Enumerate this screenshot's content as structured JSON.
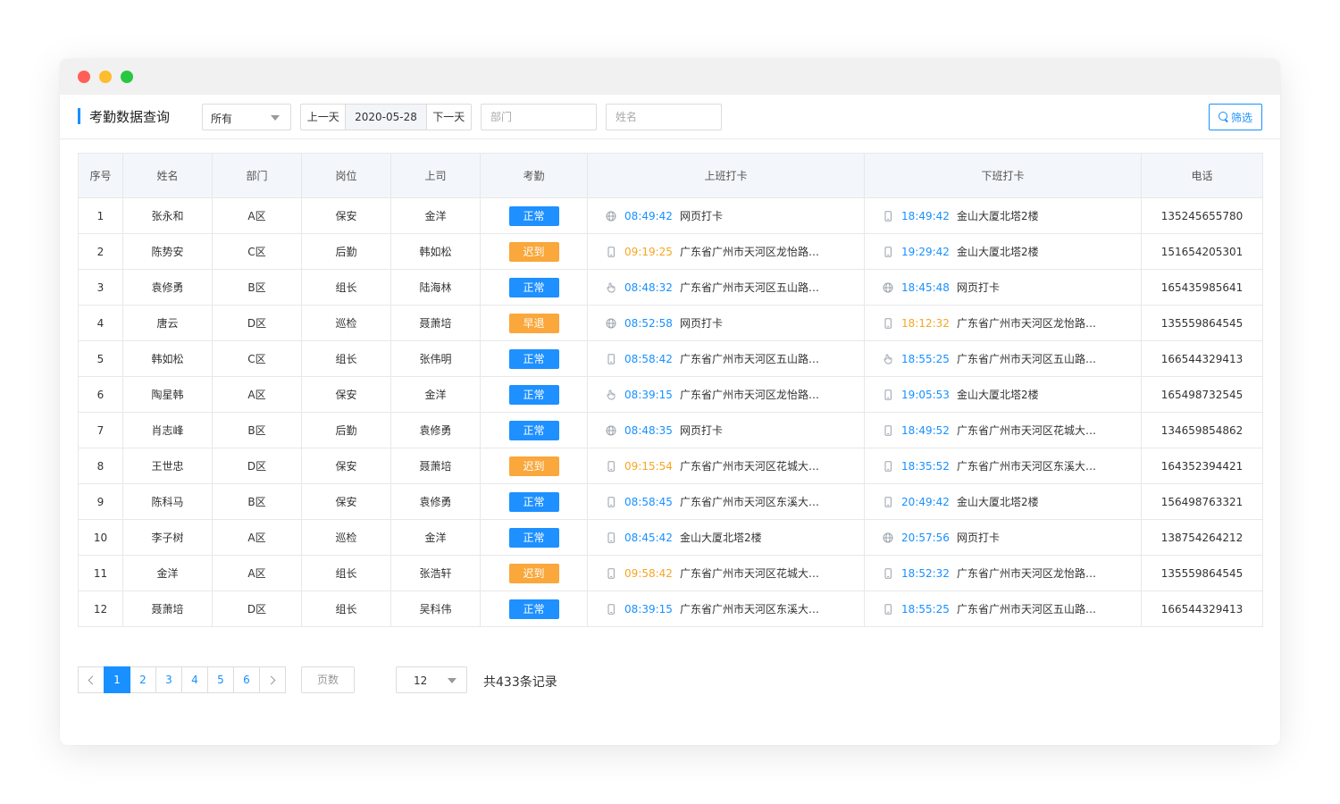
{
  "page": {
    "title": "考勤数据查询"
  },
  "toolbar": {
    "scope_select": "所有",
    "prev_day": "上一天",
    "date": "2020-05-28",
    "next_day": "下一天",
    "dept_placeholder": "部门",
    "name_placeholder": "姓名",
    "filter_label": "筛选"
  },
  "table": {
    "headers": [
      "序号",
      "姓名",
      "部门",
      "岗位",
      "上司",
      "考勤",
      "上班打卡",
      "下班打卡",
      "电话"
    ],
    "rows": [
      {
        "no": "1",
        "name": "张永和",
        "dept": "A区",
        "post": "保安",
        "boss": "金洋",
        "status": "正常",
        "status_type": "normal",
        "in": {
          "icon": "globe",
          "time": "08:49:42",
          "late": false,
          "loc": "网页打卡"
        },
        "out": {
          "icon": "phone",
          "time": "18:49:42",
          "late": false,
          "loc": "金山大厦北塔2楼"
        },
        "phone": "135245655780"
      },
      {
        "no": "2",
        "name": "陈势安",
        "dept": "C区",
        "post": "后勤",
        "boss": "韩如松",
        "status": "迟到",
        "status_type": "late",
        "in": {
          "icon": "phone",
          "time": "09:19:25",
          "late": true,
          "loc": "广东省广州市天河区龙怡路…"
        },
        "out": {
          "icon": "phone",
          "time": "19:29:42",
          "late": false,
          "loc": "金山大厦北塔2楼"
        },
        "phone": "151654205301"
      },
      {
        "no": "3",
        "name": "袁修勇",
        "dept": "B区",
        "post": "组长",
        "boss": "陆海林",
        "status": "正常",
        "status_type": "normal",
        "in": {
          "icon": "finger",
          "time": "08:48:32",
          "late": false,
          "loc": "广东省广州市天河区五山路…"
        },
        "out": {
          "icon": "globe",
          "time": "18:45:48",
          "late": false,
          "loc": "网页打卡"
        },
        "phone": "165435985641"
      },
      {
        "no": "4",
        "name": "唐云",
        "dept": "D区",
        "post": "巡检",
        "boss": "聂萧培",
        "status": "早退",
        "status_type": "late",
        "in": {
          "icon": "globe",
          "time": "08:52:58",
          "late": false,
          "loc": "网页打卡"
        },
        "out": {
          "icon": "phone",
          "time": "18:12:32",
          "late": true,
          "loc": "广东省广州市天河区龙怡路…"
        },
        "phone": "135559864545"
      },
      {
        "no": "5",
        "name": "韩如松",
        "dept": "C区",
        "post": "组长",
        "boss": "张伟明",
        "status": "正常",
        "status_type": "normal",
        "in": {
          "icon": "phone",
          "time": "08:58:42",
          "late": false,
          "loc": "广东省广州市天河区五山路…"
        },
        "out": {
          "icon": "finger",
          "time": "18:55:25",
          "late": false,
          "loc": "广东省广州市天河区五山路…"
        },
        "phone": "166544329413"
      },
      {
        "no": "6",
        "name": "陶星韩",
        "dept": "A区",
        "post": "保安",
        "boss": "金洋",
        "status": "正常",
        "status_type": "normal",
        "in": {
          "icon": "finger",
          "time": "08:39:15",
          "late": false,
          "loc": "广东省广州市天河区龙怡路…"
        },
        "out": {
          "icon": "phone",
          "time": "19:05:53",
          "late": false,
          "loc": "金山大厦北塔2楼"
        },
        "phone": "165498732545"
      },
      {
        "no": "7",
        "name": "肖志峰",
        "dept": "B区",
        "post": "后勤",
        "boss": "袁修勇",
        "status": "正常",
        "status_type": "normal",
        "in": {
          "icon": "globe",
          "time": "08:48:35",
          "late": false,
          "loc": "网页打卡"
        },
        "out": {
          "icon": "phone",
          "time": "18:49:52",
          "late": false,
          "loc": "广东省广州市天河区花城大…"
        },
        "phone": "134659854862"
      },
      {
        "no": "8",
        "name": "王世忠",
        "dept": "D区",
        "post": "保安",
        "boss": "聂萧培",
        "status": "迟到",
        "status_type": "late",
        "in": {
          "icon": "phone",
          "time": "09:15:54",
          "late": true,
          "loc": "广东省广州市天河区花城大…"
        },
        "out": {
          "icon": "phone",
          "time": "18:35:52",
          "late": false,
          "loc": "广东省广州市天河区东溪大…"
        },
        "phone": "164352394421"
      },
      {
        "no": "9",
        "name": "陈科马",
        "dept": "B区",
        "post": "保安",
        "boss": "袁修勇",
        "status": "正常",
        "status_type": "normal",
        "in": {
          "icon": "phone",
          "time": "08:58:45",
          "late": false,
          "loc": "广东省广州市天河区东溪大…"
        },
        "out": {
          "icon": "phone",
          "time": "20:49:42",
          "late": false,
          "loc": "金山大厦北塔2楼"
        },
        "phone": "156498763321"
      },
      {
        "no": "10",
        "name": "李子树",
        "dept": "A区",
        "post": "巡检",
        "boss": "金洋",
        "status": "正常",
        "status_type": "normal",
        "in": {
          "icon": "phone",
          "time": "08:45:42",
          "late": false,
          "loc": "金山大厦北塔2楼"
        },
        "out": {
          "icon": "globe",
          "time": "20:57:56",
          "late": false,
          "loc": "网页打卡"
        },
        "phone": "138754264212"
      },
      {
        "no": "11",
        "name": "金洋",
        "dept": "A区",
        "post": "组长",
        "boss": "张浩轩",
        "status": "迟到",
        "status_type": "late",
        "in": {
          "icon": "phone",
          "time": "09:58:42",
          "late": true,
          "loc": "广东省广州市天河区花城大…"
        },
        "out": {
          "icon": "phone",
          "time": "18:52:32",
          "late": false,
          "loc": "广东省广州市天河区龙怡路…"
        },
        "phone": "135559864545"
      },
      {
        "no": "12",
        "name": "聂萧培",
        "dept": "D区",
        "post": "组长",
        "boss": "吴科伟",
        "status": "正常",
        "status_type": "normal",
        "in": {
          "icon": "phone",
          "time": "08:39:15",
          "late": false,
          "loc": "广东省广州市天河区东溪大…"
        },
        "out": {
          "icon": "phone",
          "time": "18:55:25",
          "late": false,
          "loc": "广东省广州市天河区五山路…"
        },
        "phone": "166544329413"
      }
    ]
  },
  "pagination": {
    "pages": [
      "1",
      "2",
      "3",
      "4",
      "5",
      "6"
    ],
    "current": "1",
    "page_input_placeholder": "页数",
    "page_size": "12",
    "total": "共433条记录"
  },
  "colors": {
    "accent": "#1890ff",
    "normal_badge": "#1e90ff",
    "late_badge": "#faa73b",
    "late_time": "#f5a623"
  }
}
